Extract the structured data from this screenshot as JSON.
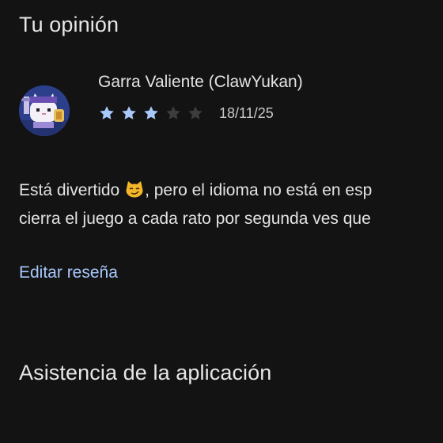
{
  "opinion": {
    "title": "Tu opinión"
  },
  "review": {
    "author": "Garra Valiente (ClawYukan)",
    "rating": 3,
    "max_rating": 5,
    "date": "18/11/25",
    "text_line1_before_emoji": "Está divertido",
    "emoji": "😼",
    "text_line1_after_emoji": ", pero el idioma no está en esp",
    "text_line2": "cierra el juego a cada rato por segunda ves que",
    "edit_label": "Editar reseña"
  },
  "support": {
    "title": "Asistencia de la aplicación"
  },
  "icons": {
    "avatar": "avatar-cat-knight-icon",
    "star": "star-icon"
  },
  "colors": {
    "background": "#131313",
    "star_filled": "#a8c7fa",
    "star_empty": "#3c3c3c",
    "link": "#a8c7fa"
  }
}
